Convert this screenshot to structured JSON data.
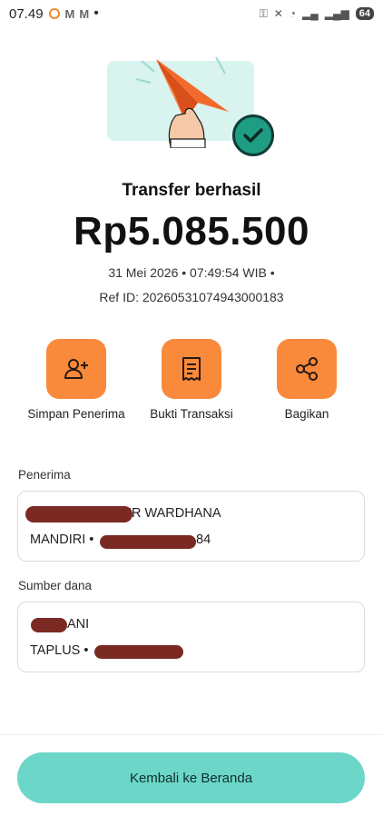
{
  "status_bar": {
    "time": "07.49",
    "battery": "64",
    "colors": {
      "notification_ring": "#f08a2c"
    }
  },
  "result": {
    "title": "Transfer berhasil",
    "amount": "Rp5.085.500",
    "datetime": "31 Mei 2026 • 07:49:54 WIB •",
    "ref_id": "Ref ID: 20260531074943000183"
  },
  "actions": [
    {
      "label": "Simpan Penerima",
      "icon": "add-user-icon"
    },
    {
      "label": "Bukti Transaksi",
      "icon": "receipt-icon"
    },
    {
      "label": "Bagikan",
      "icon": "share-icon"
    }
  ],
  "recipient": {
    "section_label": "Penerima",
    "name_visible": "NUR WARDHANA",
    "bank_prefix": "MANDIRI •",
    "account_suffix": "84"
  },
  "source": {
    "section_label": "Sumber dana",
    "name_visible": "ANI",
    "account_prefix": "TAPLUS •"
  },
  "footer": {
    "home_button_label": "Kembali ke Beranda"
  },
  "colors": {
    "action_orange": "#f98a3c",
    "button_teal": "#6cd6c8",
    "success_green": "#1f9d84",
    "redaction": "#7a2a22"
  }
}
